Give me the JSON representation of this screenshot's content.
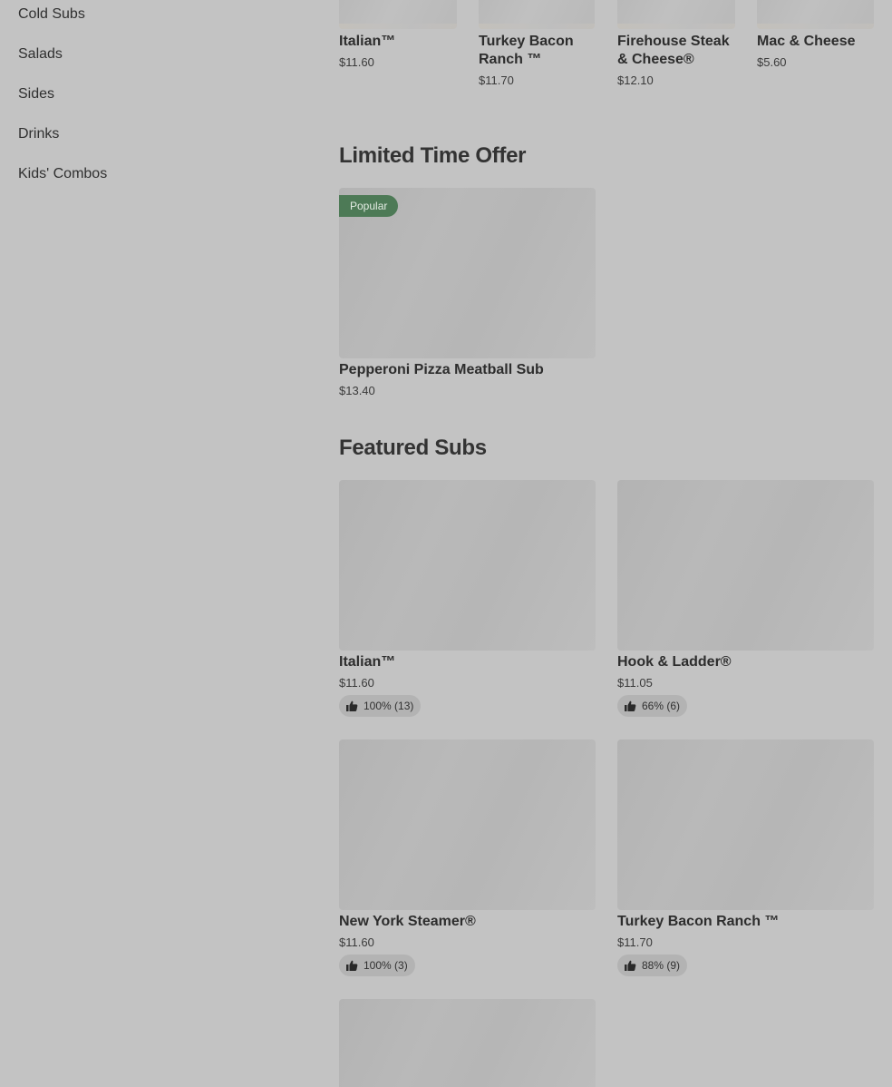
{
  "sidebar": {
    "items": [
      {
        "label": "Cold Subs"
      },
      {
        "label": "Salads"
      },
      {
        "label": "Sides"
      },
      {
        "label": "Drinks"
      },
      {
        "label": "Kids' Combos"
      }
    ]
  },
  "top_row": [
    {
      "name": "Italian™",
      "price": "$11.60"
    },
    {
      "name": "Turkey Bacon Ranch ™",
      "price": "$11.70"
    },
    {
      "name": "Firehouse Steak & Cheese®",
      "price": "$12.10"
    },
    {
      "name": "Mac & Cheese",
      "price": "$5.60"
    }
  ],
  "limited": {
    "title": "Limited Time Offer",
    "item": {
      "badge": "Popular",
      "name": "Pepperoni Pizza Meatball Sub",
      "price": "$13.40"
    }
  },
  "featured": {
    "title": "Featured Subs",
    "items": [
      {
        "name": "Italian™",
        "price": "$11.60",
        "rating": "100% (13)"
      },
      {
        "name": "Hook & Ladder®",
        "price": "$11.05",
        "rating": "66% (6)"
      },
      {
        "name": "New York Steamer®",
        "price": "$11.60",
        "rating": "100% (3)"
      },
      {
        "name": "Turkey Bacon Ranch ™",
        "price": "$11.70",
        "rating": "88% (9)"
      }
    ]
  },
  "icons": {
    "rating": "thumbs-up-icon"
  }
}
